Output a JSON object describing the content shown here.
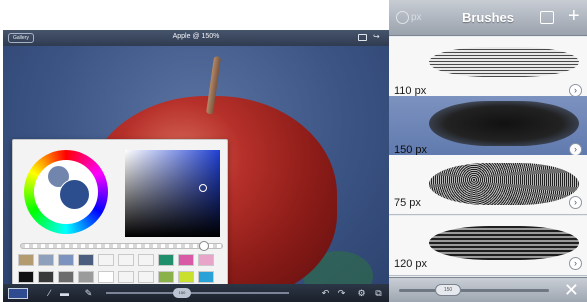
{
  "topbar": {
    "gallery_label": "Gallery",
    "title": "Apple @ 150%",
    "image_icon": "image-icon",
    "share_icon": "share-icon"
  },
  "color_picker": {
    "current_color": "#2c4e8e",
    "previous_color": "#7286ad",
    "palette": [
      "#b39a6f",
      "#8fa0bd",
      "#7c93bf",
      "#4a5d7e",
      "#f4f4f4",
      "#f4f4f4",
      "#f4f4f4",
      "#1f8f6c",
      "#d85aa7",
      "#e9a5c9",
      "#111111",
      "#3a3a3a",
      "#6c6c6c",
      "#9b9b9b",
      "#ffffff",
      "#f4f4f4",
      "#f4f4f4",
      "#8bb24a",
      "#c9e02f",
      "#2aa2d8"
    ]
  },
  "toolbar_left": {
    "color_swatch": "#2e4c8f",
    "brush_size_label": "150"
  },
  "brushes_panel": {
    "header_size_label": "px",
    "title": "Brushes",
    "settings_icon": "brush-settings-icon",
    "add_icon": "add-icon",
    "items": [
      {
        "label": "110 px",
        "selected": false
      },
      {
        "label": "150 px",
        "selected": true
      },
      {
        "label": "75 px",
        "selected": false
      },
      {
        "label": "120 px",
        "selected": false
      }
    ],
    "footer_slider_label": "150",
    "close_icon": "close-icon"
  }
}
